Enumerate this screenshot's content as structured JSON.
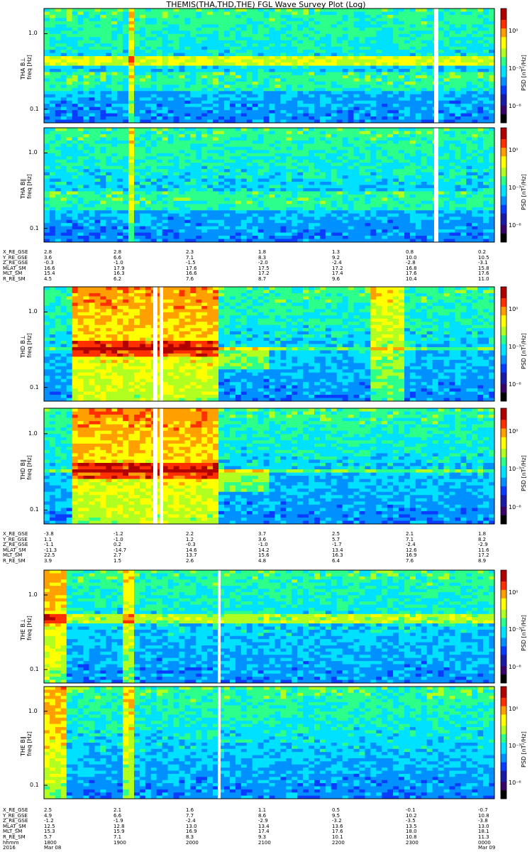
{
  "title": "THEMIS(THA,THD,THE) FGL Wave Survey Plot (Log)",
  "chart_data": [
    {
      "type": "heatmap",
      "panels": [
        {
          "id": "tha_bperp",
          "ylabel_probe": "THA B⊥",
          "ylabel_freq": "freq [Hz]",
          "cbar_label": "PSD [nT²/Hz]",
          "yticks": [
            "1.0",
            "0.1"
          ],
          "cbar_ticks": [
            "10⁰",
            "10⁻³",
            "10⁻⁶"
          ],
          "gap_time": "~23:30"
        },
        {
          "id": "tha_bpar",
          "ylabel_probe": "THA B∥",
          "ylabel_freq": "freq [Hz]",
          "cbar_label": "PSD [nT²/Hz]",
          "yticks": [
            "1.0",
            "0.1"
          ],
          "cbar_ticks": [
            "10⁰",
            "10⁻³",
            "10⁻⁶"
          ],
          "gap_time": "~23:30"
        }
      ],
      "ephemeris": {
        "names": [
          "X_RE_GSE",
          "Y_RE_GSE",
          "Z_RE_GSE",
          "MLAT_SM",
          "MLT_SM",
          "R_RE_SM"
        ],
        "columns": [
          [
            "2.8",
            "3.6",
            "-0.3",
            "16.6",
            "15.4",
            "4.5"
          ],
          [
            "2.8",
            "6.6",
            "-1.0",
            "17.9",
            "16.3",
            "6.2"
          ],
          [
            "2.3",
            "7.1",
            "-1.5",
            "17.6",
            "16.6",
            "7.6"
          ],
          [
            "1.8",
            "8.3",
            "-2.0",
            "17.5",
            "17.2",
            "8.7"
          ],
          [
            "1.3",
            "9.2",
            "-2.4",
            "17.2",
            "17.4",
            "9.6"
          ],
          [
            "0.8",
            "10.0",
            "-2.8",
            "16.8",
            "17.6",
            "10.4"
          ],
          [
            "0.2",
            "10.5",
            "-3.1",
            "15.8",
            "17.6",
            "11.0"
          ]
        ]
      }
    },
    {
      "type": "heatmap",
      "panels": [
        {
          "id": "thd_bperp",
          "ylabel_probe": "THD B⊥",
          "ylabel_freq": "freq [Hz]",
          "cbar_label": "PSD [nT²/Hz]",
          "yticks": [
            "1.0",
            "0.1"
          ],
          "cbar_ticks": [
            "10⁰",
            "10⁻³",
            "10⁻⁶"
          ]
        },
        {
          "id": "thd_bpar",
          "ylabel_probe": "THD B∥",
          "ylabel_freq": "freq [Hz]",
          "cbar_label": "PSD [nT²/Hz]",
          "yticks": [
            "1.0",
            "0.1"
          ],
          "cbar_ticks": [
            "10⁰",
            "10⁻³",
            "10⁻⁶"
          ]
        }
      ],
      "ephemeris": {
        "names": [
          "X_RE_GSE",
          "Y_RE_GSE",
          "Z_RE_GSE",
          "MLAT_SM",
          "MLT_SM",
          "R_RE_SM"
        ],
        "columns": [
          [
            "-3.8",
            "1.1",
            "-1.1",
            "-11.3",
            "22.5",
            "3.9"
          ],
          [
            "-1.2",
            "-1.0",
            "0.2",
            "-14.7",
            "2.7",
            "1.5"
          ],
          [
            "2.2",
            "1.2",
            "-0.3",
            "14.6",
            "13.7",
            "2.6"
          ],
          [
            "3.7",
            "3.6",
            "-1.0",
            "14.2",
            "15.6",
            "4.8"
          ],
          [
            "2.5",
            "5.7",
            "-1.7",
            "13.4",
            "16.3",
            "6.4"
          ],
          [
            "2.1",
            "7.1",
            "-2.4",
            "12.6",
            "16.9",
            "7.6"
          ],
          [
            "1.8",
            "8.2",
            "-2.9",
            "11.6",
            "17.2",
            "8.9"
          ]
        ]
      }
    },
    {
      "type": "heatmap",
      "panels": [
        {
          "id": "the_bperp",
          "ylabel_probe": "THE B⊥",
          "ylabel_freq": "freq [Hz]",
          "cbar_label": "PSD [nT²/Hz]",
          "yticks": [
            "1.0",
            "0.1"
          ],
          "cbar_ticks": [
            "10⁰",
            "10⁻³",
            "10⁻⁶"
          ],
          "gap_time": "~20:10"
        },
        {
          "id": "the_bpar",
          "ylabel_probe": "THE B∥",
          "ylabel_freq": "freq [Hz]",
          "cbar_label": "PSD [nT²/Hz]",
          "yticks": [
            "1.0",
            "0.1"
          ],
          "cbar_ticks": [
            "10⁰",
            "10⁻³",
            "10⁻⁶"
          ],
          "gap_time": "~20:10"
        }
      ],
      "ephemeris": {
        "names": [
          "X_RE_GSE",
          "Y_RE_GSE",
          "Z_RE_GSE",
          "MLAT_SM",
          "MLT_SM",
          "R_RE_SM",
          "hhmm",
          "2016"
        ],
        "columns": [
          [
            "2.5",
            "4.9",
            "-1.2",
            "12.5",
            "15.3",
            "5.7",
            "1800",
            "Mar 08"
          ],
          [
            "2.1",
            "6.6",
            "-1.9",
            "12.8",
            "15.9",
            "7.1",
            "1900",
            ""
          ],
          [
            "1.6",
            "7.7",
            "-2.4",
            "13.0",
            "16.9",
            "8.3",
            "2000",
            ""
          ],
          [
            "1.1",
            "8.6",
            "-2.9",
            "13.4",
            "17.4",
            "9.3",
            "2100",
            ""
          ],
          [
            "0.5",
            "9.5",
            "-3.2",
            "13.6",
            "17.6",
            "10.1",
            "2200",
            ""
          ],
          [
            "-0.1",
            "10.2",
            "-3.5",
            "13.5",
            "18.0",
            "10.8",
            "2300",
            ""
          ],
          [
            "-0.7",
            "10.8",
            "-3.8",
            "13.0",
            "18.1",
            "11.3",
            "0000",
            "Mar 09"
          ]
        ]
      },
      "time_axis": {
        "start": "1800",
        "end": "0000",
        "date_start": "Mar 08",
        "date_end": "Mar 09",
        "year": "2016"
      }
    }
  ],
  "colorscale": [
    "#000000",
    "#3a006a",
    "#1a1aa6",
    "#0a3cff",
    "#0090ff",
    "#00e0ff",
    "#2cff8a",
    "#b0ff20",
    "#ffff00",
    "#ffa000",
    "#ff3000",
    "#b00000"
  ]
}
